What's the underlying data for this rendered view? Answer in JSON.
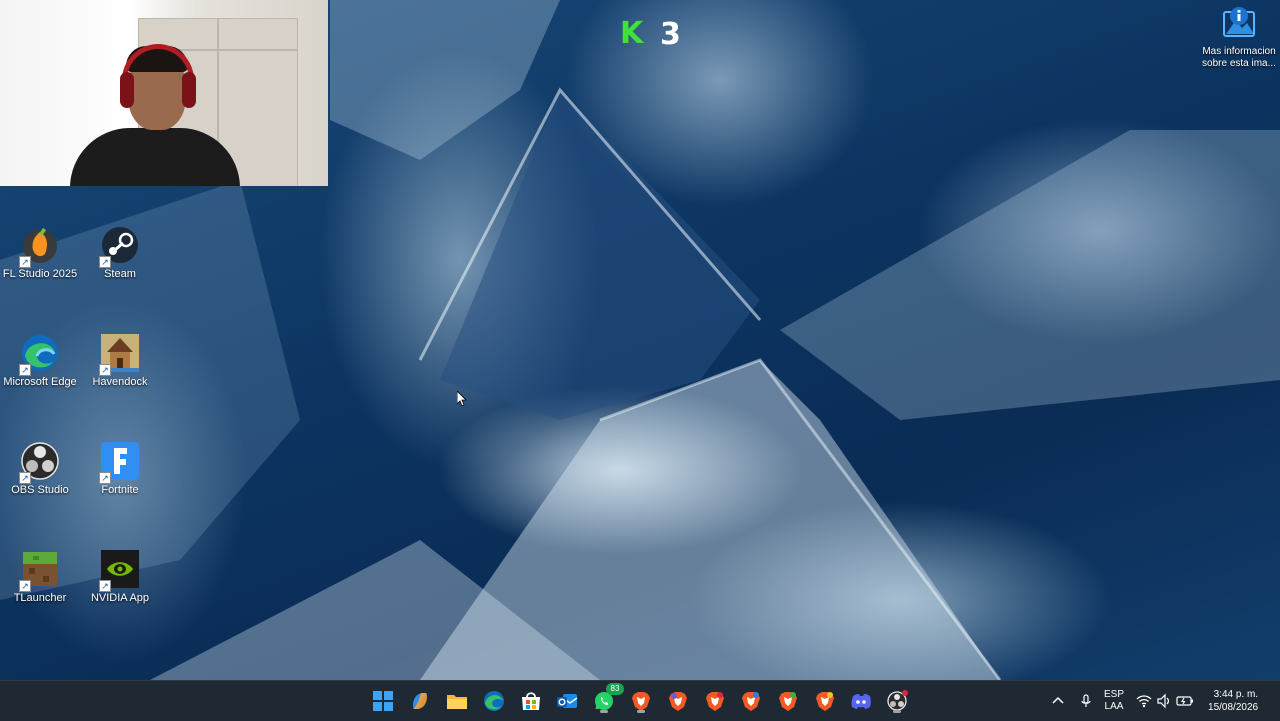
{
  "overlay": {
    "counter_logo": "K",
    "counter_value": "3"
  },
  "spotlight": {
    "label_line1": "Mas informacion",
    "label_line2": "sobre esta ima..."
  },
  "desktop_icons": [
    {
      "label": "FL Studio 2025",
      "icon": "fl-studio-icon"
    },
    {
      "label": "Steam",
      "icon": "steam-icon"
    },
    {
      "label": "Microsoft Edge",
      "icon": "edge-icon"
    },
    {
      "label": "Havendock",
      "icon": "havendock-icon"
    },
    {
      "label": "OBS Studio",
      "icon": "obs-icon"
    },
    {
      "label": "Fortnite",
      "icon": "fortnite-icon"
    },
    {
      "label": "TLauncher",
      "icon": "tlauncher-icon"
    },
    {
      "label": "NVIDIA App",
      "icon": "nvidia-icon"
    }
  ],
  "taskbar": {
    "pinned": [
      {
        "name": "start-button",
        "icon": "windows-logo-icon"
      },
      {
        "name": "copilot",
        "icon": "copilot-icon"
      },
      {
        "name": "file-explorer",
        "icon": "folder-icon"
      },
      {
        "name": "edge",
        "icon": "edge-icon"
      },
      {
        "name": "store",
        "icon": "store-icon"
      },
      {
        "name": "outlook",
        "icon": "outlook-icon"
      },
      {
        "name": "whatsapp",
        "icon": "whatsapp-icon",
        "badge": "83"
      },
      {
        "name": "brave-1",
        "icon": "brave-icon"
      },
      {
        "name": "brave-2",
        "icon": "brave-icon"
      },
      {
        "name": "brave-3",
        "icon": "brave-icon"
      },
      {
        "name": "brave-4",
        "icon": "brave-icon"
      },
      {
        "name": "brave-5",
        "icon": "brave-icon"
      },
      {
        "name": "brave-6",
        "icon": "brave-icon"
      },
      {
        "name": "discord",
        "icon": "discord-icon"
      },
      {
        "name": "obs",
        "icon": "obs-icon"
      }
    ],
    "tray": {
      "language_line1": "ESP",
      "language_line2": "LAA",
      "time": "3:44 p. m.",
      "date": "15/08/2026"
    }
  },
  "colors": {
    "taskbar_bg": "#1f2933",
    "counter_green": "#3ee23a",
    "whatsapp_green": "#1aa251",
    "brave_orange": "#f15a24"
  }
}
